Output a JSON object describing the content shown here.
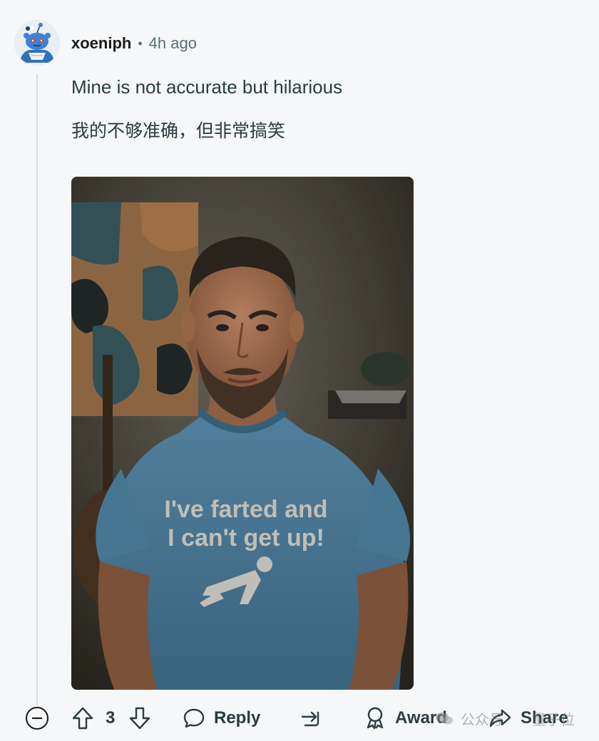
{
  "comment": {
    "username": "xoeniph",
    "separator": "•",
    "timestamp": "4h ago",
    "lines": [
      "Mine is not accurate but hilarious",
      "我的不够准确，但非常搞笑"
    ],
    "image": {
      "shirt_text_line1": "I've farted and",
      "shirt_text_line2": "I can't get up!"
    }
  },
  "actions": {
    "collapse_icon": "minus-circle-icon",
    "upvote_icon": "arrow-up-icon",
    "score": "3",
    "downvote_icon": "arrow-down-icon",
    "reply_label": "Reply",
    "forward_icon": "crosspost-icon",
    "award_label": "Award",
    "share_label": "Share"
  },
  "watermark": {
    "left_text": "公众号",
    "right_text": "量子位"
  },
  "colors": {
    "background": "#f6f7f8",
    "text": "#1a1a1b",
    "muted": "#576f76",
    "action": "#2a3c42",
    "avatar_blue": "#3b83d6"
  }
}
